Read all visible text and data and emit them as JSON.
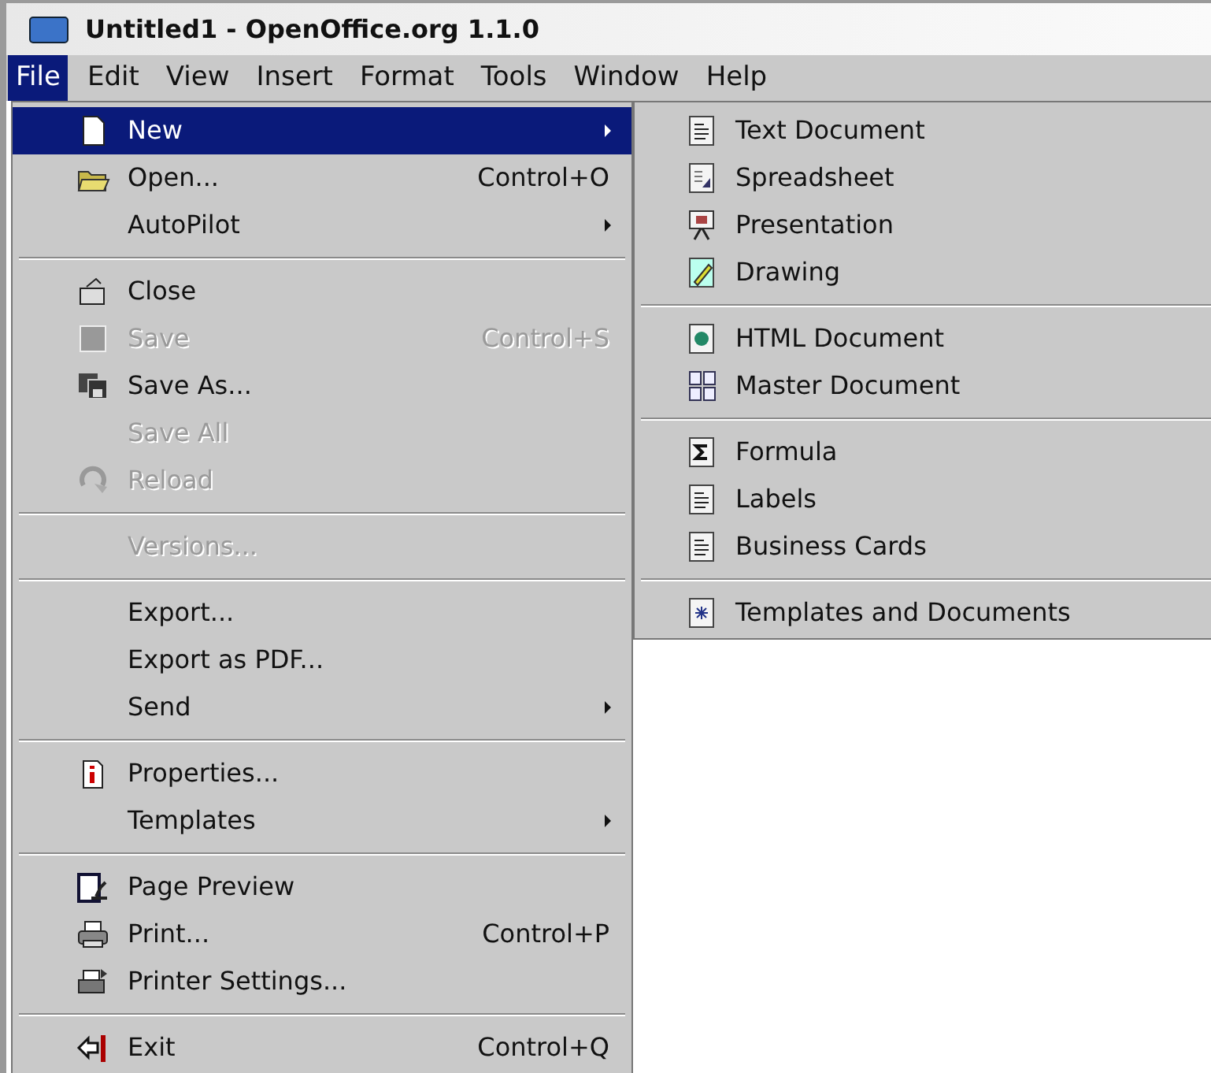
{
  "window": {
    "title": "Untitled1 - OpenOffice.org 1.1.0"
  },
  "menu_bar": [
    {
      "label": "File",
      "selected": true
    },
    {
      "label": "Edit",
      "selected": false
    },
    {
      "label": "View",
      "selected": false
    },
    {
      "label": "Insert",
      "selected": false
    },
    {
      "label": "Format",
      "selected": false
    },
    {
      "label": "Tools",
      "selected": false
    },
    {
      "label": "Window",
      "selected": false
    },
    {
      "label": "Help",
      "selected": false
    }
  ],
  "file_menu": [
    {
      "kind": "item",
      "label": "New",
      "selected": true,
      "disabled": false,
      "submenu": true
    },
    {
      "kind": "item",
      "label": "Open...",
      "shortcut": "Control+O",
      "selected": false,
      "disabled": false,
      "submenu": false
    },
    {
      "kind": "item",
      "label": "AutoPilot",
      "selected": false,
      "disabled": false,
      "submenu": true
    },
    {
      "kind": "separator"
    },
    {
      "kind": "item",
      "label": "Close",
      "selected": false,
      "disabled": false,
      "submenu": false
    },
    {
      "kind": "item",
      "label": "Save",
      "shortcut": "Control+S",
      "selected": false,
      "disabled": true,
      "submenu": false
    },
    {
      "kind": "item",
      "label": "Save As...",
      "selected": false,
      "disabled": false,
      "submenu": false
    },
    {
      "kind": "item",
      "label": "Save All",
      "selected": false,
      "disabled": true,
      "submenu": false
    },
    {
      "kind": "item",
      "label": "Reload",
      "selected": false,
      "disabled": true,
      "submenu": false
    },
    {
      "kind": "separator"
    },
    {
      "kind": "item",
      "label": "Versions...",
      "selected": false,
      "disabled": true,
      "submenu": false
    },
    {
      "kind": "separator"
    },
    {
      "kind": "item",
      "label": "Export...",
      "selected": false,
      "disabled": false,
      "submenu": false
    },
    {
      "kind": "item",
      "label": "Export as PDF...",
      "selected": false,
      "disabled": false,
      "submenu": false
    },
    {
      "kind": "item",
      "label": "Send",
      "selected": false,
      "disabled": false,
      "submenu": true
    },
    {
      "kind": "separator"
    },
    {
      "kind": "item",
      "label": "Properties...",
      "selected": false,
      "disabled": false,
      "submenu": false
    },
    {
      "kind": "item",
      "label": "Templates",
      "selected": false,
      "disabled": false,
      "submenu": true
    },
    {
      "kind": "separator"
    },
    {
      "kind": "item",
      "label": "Page Preview",
      "selected": false,
      "disabled": false,
      "submenu": false
    },
    {
      "kind": "item",
      "label": "Print...",
      "shortcut": "Control+P",
      "selected": false,
      "disabled": false,
      "submenu": false
    },
    {
      "kind": "item",
      "label": "Printer Settings...",
      "selected": false,
      "disabled": false,
      "submenu": false
    },
    {
      "kind": "separator"
    },
    {
      "kind": "item",
      "label": "Exit",
      "shortcut": "Control+Q",
      "selected": false,
      "disabled": false,
      "submenu": false
    }
  ],
  "new_submenu": [
    {
      "kind": "item",
      "label": "Text Document"
    },
    {
      "kind": "item",
      "label": "Spreadsheet"
    },
    {
      "kind": "item",
      "label": "Presentation"
    },
    {
      "kind": "item",
      "label": "Drawing"
    },
    {
      "kind": "separator"
    },
    {
      "kind": "item",
      "label": "HTML Document"
    },
    {
      "kind": "item",
      "label": "Master Document"
    },
    {
      "kind": "separator"
    },
    {
      "kind": "item",
      "label": "Formula"
    },
    {
      "kind": "item",
      "label": "Labels"
    },
    {
      "kind": "item",
      "label": "Business Cards"
    },
    {
      "kind": "separator"
    },
    {
      "kind": "item",
      "label": "Templates and Documents"
    }
  ]
}
